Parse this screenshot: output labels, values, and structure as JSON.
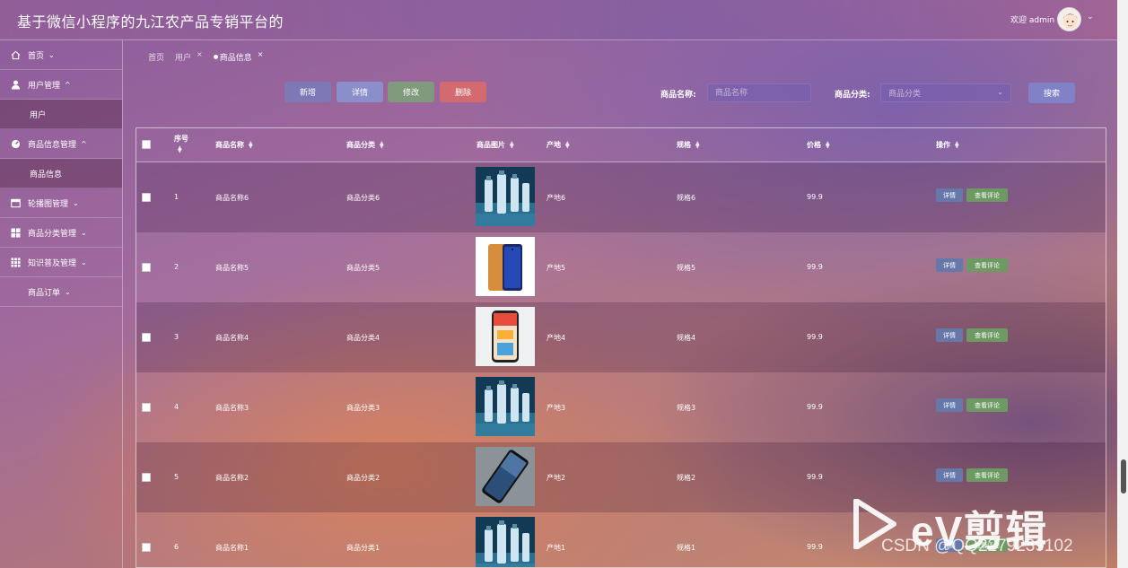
{
  "header": {
    "title": "基于微信小程序的九江农产品专销平台的",
    "welcome": "欢迎 admin"
  },
  "sidebar": {
    "items": [
      {
        "label": "首页",
        "icon": "home-icon"
      },
      {
        "label": "用户管理",
        "icon": "user-icon",
        "sub": "用户"
      },
      {
        "label": "商品信息管理",
        "icon": "dashboard-icon",
        "sub": "商品信息"
      },
      {
        "label": "轮播图管理",
        "icon": "picture-icon"
      },
      {
        "label": "商品分类管理",
        "icon": "grid-icon"
      },
      {
        "label": "知识普及管理",
        "icon": "apps-icon"
      },
      {
        "label": "商品订单",
        "icon": ""
      }
    ]
  },
  "breadcrumb": {
    "home": "首页",
    "user": "用户",
    "current": "商品信息",
    "close": "×"
  },
  "toolbar": {
    "new": "新增",
    "detail": "详情",
    "edit": "修改",
    "delete": "删除",
    "search": "搜索",
    "name_label": "商品名称:",
    "name_placeholder": "商品名称",
    "category_label": "商品分类:",
    "category_placeholder": "商品分类"
  },
  "table": {
    "headers": {
      "index": "序号",
      "name": "商品名称",
      "category": "商品分类",
      "image": "商品图片",
      "origin": "产地",
      "spec": "规格",
      "price": "价格",
      "ops": "操作"
    },
    "op_detail": "详情",
    "op_review": "查看评论",
    "rows": [
      {
        "index": "1",
        "name": "商品名称6",
        "category": "商品分类6",
        "origin": "产地6",
        "spec": "规格6",
        "price": "99.9",
        "image": "cosmetics"
      },
      {
        "index": "2",
        "name": "商品名称5",
        "category": "商品分类5",
        "origin": "产地5",
        "spec": "规格5",
        "price": "99.9",
        "image": "phone-orange"
      },
      {
        "index": "3",
        "name": "商品名称4",
        "category": "商品分类4",
        "origin": "产地4",
        "spec": "规格4",
        "price": "99.9",
        "image": "phone-screen"
      },
      {
        "index": "4",
        "name": "商品名称3",
        "category": "商品分类3",
        "origin": "产地3",
        "spec": "规格3",
        "price": "99.9",
        "image": "cosmetics"
      },
      {
        "index": "5",
        "name": "商品名称2",
        "category": "商品分类2",
        "origin": "产地2",
        "spec": "规格2",
        "price": "99.9",
        "image": "phone-black"
      },
      {
        "index": "6",
        "name": "商品名称1",
        "category": "商品分类1",
        "origin": "产地1",
        "spec": "规格1",
        "price": "99.9",
        "image": "cosmetics"
      }
    ]
  },
  "watermark": {
    "brand": "eV剪辑",
    "csdn": "CSDN @QQ2279239102"
  }
}
